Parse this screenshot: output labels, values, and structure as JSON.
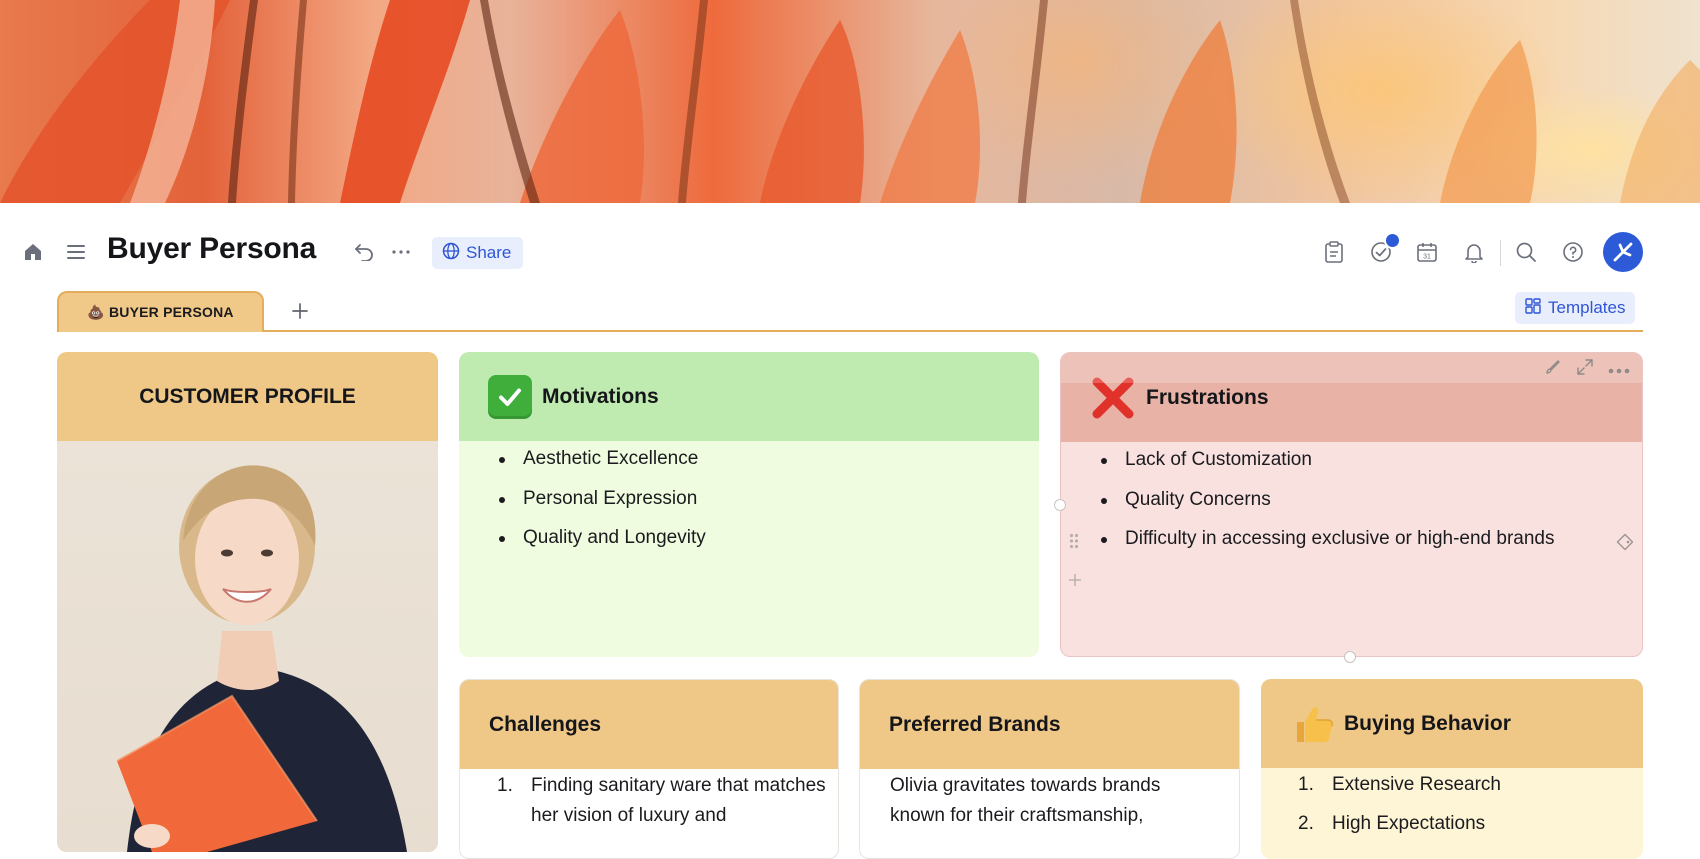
{
  "doc": {
    "title": "Buyer Persona",
    "share_label": "Share",
    "templates_label": "Templates"
  },
  "tabs": [
    {
      "label": "💩 BUYER PERSONA"
    }
  ],
  "customer_profile": {
    "heading": "CUSTOMER PROFILE"
  },
  "motivations": {
    "heading": "Motivations",
    "items": [
      "Aesthetic Excellence",
      "Personal Expression",
      "Quality and Longevity"
    ]
  },
  "frustrations": {
    "heading": "Frustrations",
    "items": [
      "Lack of Customization",
      "Quality Concerns",
      "Difficulty in accessing exclusive or high-end brands"
    ]
  },
  "challenges": {
    "heading": "Challenges",
    "items": [
      {
        "num": "1.",
        "text": "Finding sanitary ware that matches her vision of luxury and"
      }
    ]
  },
  "preferred_brands": {
    "heading": "Preferred Brands",
    "text": "Olivia gravitates towards brands known for their craftsmanship,"
  },
  "buying_behavior": {
    "heading": "Buying Behavior",
    "items": [
      {
        "num": "1.",
        "text": "Extensive Research"
      },
      {
        "num": "2.",
        "text": "High Expectations"
      }
    ]
  },
  "colors": {
    "accent_blue": "#2d5bd8",
    "profile_header": "#efc888",
    "motivations_header": "#bfeab0",
    "motivations_body": "#effcdf",
    "frustrations_header": "#e8b3a6",
    "frustrations_body": "#f9e1df",
    "buying_body": "#fdf5d6"
  },
  "icons": {
    "home": "home-icon",
    "menu": "menu-icon",
    "undo": "undo-icon",
    "more": "more-icon",
    "globe": "globe-icon",
    "tasks": "clipboard-icon",
    "check": "check-circle-icon",
    "calendar": "calendar-icon",
    "bell": "bell-icon",
    "search": "search-icon",
    "help": "help-icon"
  }
}
